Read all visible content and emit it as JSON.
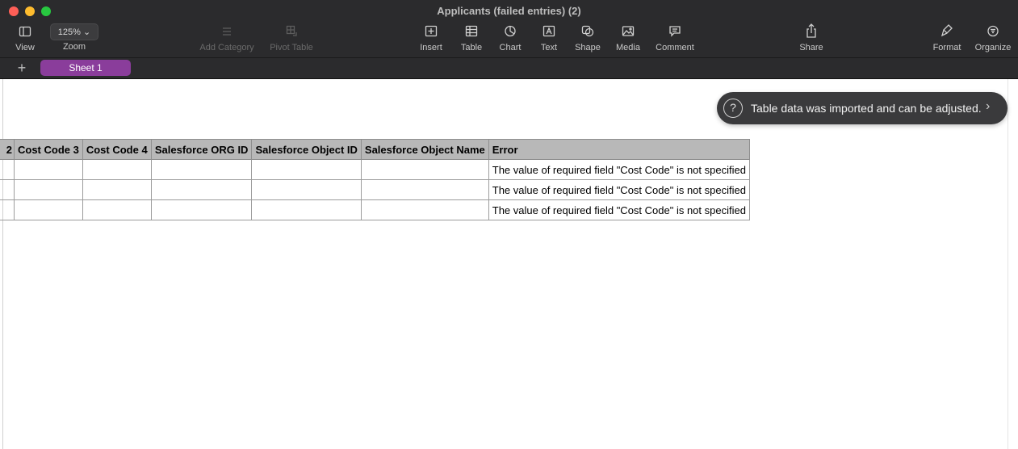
{
  "window": {
    "title": "Applicants (failed entries) (2)"
  },
  "toolbar": {
    "view_label": "View",
    "zoom_value": "125% ⌄",
    "zoom_label": "Zoom",
    "add_category_label": "Add Category",
    "pivot_table_label": "Pivot Table",
    "insert_label": "Insert",
    "table_label": "Table",
    "chart_label": "Chart",
    "text_label": "Text",
    "shape_label": "Shape",
    "media_label": "Media",
    "comment_label": "Comment",
    "share_label": "Share",
    "format_label": "Format",
    "organize_label": "Organize"
  },
  "sheets": {
    "add_label": "+",
    "active_tab": "Sheet 1"
  },
  "toast": {
    "message": "Table data was imported and can be adjusted.",
    "icon": "question-circle-icon",
    "chevron": "›"
  },
  "table": {
    "columns": [
      "2",
      "Cost Code 3",
      "Cost Code 4",
      "Salesforce ORG ID",
      "Salesforce Object ID",
      "Salesforce Object Name",
      "Error"
    ],
    "rows": [
      [
        "",
        "",
        "",
        "",
        "",
        "",
        "The value of required field \"Cost Code\" is not specified"
      ],
      [
        "",
        "",
        "",
        "",
        "",
        "",
        "The value of required field \"Cost Code\" is not specified"
      ],
      [
        "",
        "",
        "",
        "",
        "",
        "",
        "The value of required field \"Cost Code\" is not specified"
      ]
    ]
  },
  "colors": {
    "titlebar": "#2b2b2d",
    "sheet_tab": "#8a3d9b",
    "header_fill": "#b8b8b8",
    "toast": "#3a3a3c"
  }
}
